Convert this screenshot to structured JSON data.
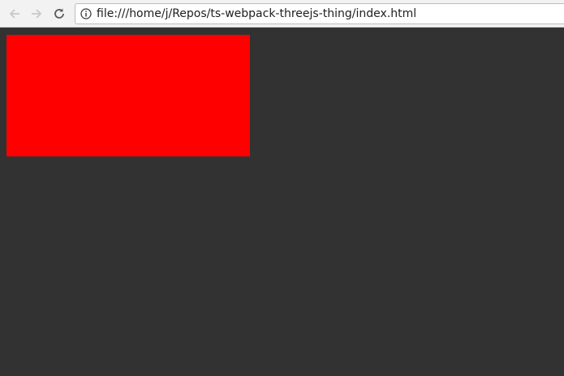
{
  "browser": {
    "url": "file:///home/j/Repos/ts-webpack-threejs-thing/index.html",
    "buttons": {
      "back_icon": "arrow-left-icon",
      "forward_icon": "arrow-right-icon",
      "reload_icon": "reload-icon",
      "info_icon": "info-icon"
    }
  },
  "page": {
    "background_color": "#323232",
    "canvas_color": "#ff0000"
  }
}
